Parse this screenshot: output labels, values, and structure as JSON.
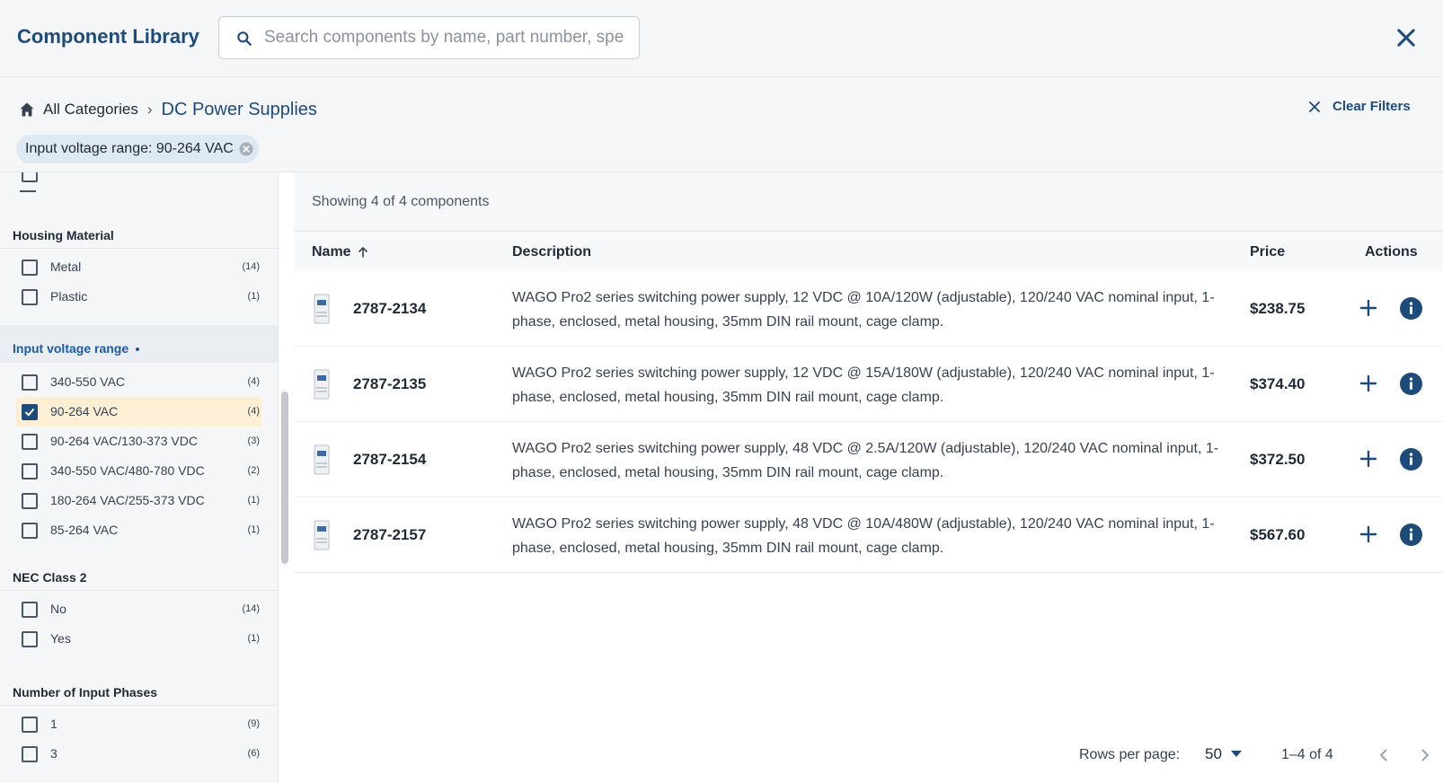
{
  "header": {
    "title": "Component Library",
    "search_placeholder": "Search components by name, part number, specification…",
    "search_value": ""
  },
  "breadcrumb": {
    "root": "All Categories",
    "separator": "›",
    "current": "DC Power Supplies"
  },
  "clear_filters_label": "Clear Filters",
  "active_filter_chip": "Input voltage range: 90-264 VAC",
  "sidebar": {
    "groups": [
      {
        "title": "Housing Material",
        "active": false,
        "options": [
          {
            "label": "Metal",
            "count": "(14)",
            "checked": false
          },
          {
            "label": "Plastic",
            "count": "(1)",
            "checked": false
          }
        ]
      },
      {
        "title": "Input voltage range",
        "active": true,
        "options": [
          {
            "label": "340-550 VAC",
            "count": "(4)",
            "checked": false
          },
          {
            "label": "90-264 VAC",
            "count": "(4)",
            "checked": true
          },
          {
            "label": "90-264 VAC/130-373 VDC",
            "count": "(3)",
            "checked": false
          },
          {
            "label": "340-550 VAC/480-780 VDC",
            "count": "(2)",
            "checked": false
          },
          {
            "label": "180-264 VAC/255-373 VDC",
            "count": "(1)",
            "checked": false
          },
          {
            "label": "85-264 VAC",
            "count": "(1)",
            "checked": false
          }
        ]
      },
      {
        "title": "NEC Class 2",
        "active": false,
        "options": [
          {
            "label": "No",
            "count": "(14)",
            "checked": false
          },
          {
            "label": "Yes",
            "count": "(1)",
            "checked": false
          }
        ]
      },
      {
        "title": "Number of Input Phases",
        "active": false,
        "options": [
          {
            "label": "1",
            "count": "(9)",
            "checked": false
          },
          {
            "label": "3",
            "count": "(6)",
            "checked": false
          }
        ]
      }
    ]
  },
  "results": {
    "showing_text": "Showing 4 of 4 components",
    "columns": {
      "name": "Name",
      "description": "Description",
      "price": "Price",
      "actions": "Actions"
    },
    "rows": [
      {
        "part_number": "2787-2134",
        "description": "WAGO Pro2 series switching power supply, 12 VDC @ 10A/120W (adjustable), 120/240 VAC nominal input, 1-phase, enclosed, metal housing, 35mm DIN rail mount, cage clamp.",
        "price": "$238.75"
      },
      {
        "part_number": "2787-2135",
        "description": "WAGO Pro2 series switching power supply, 12 VDC @ 15A/180W (adjustable), 120/240 VAC nominal input, 1-phase, enclosed, metal housing, 35mm DIN rail mount, cage clamp.",
        "price": "$374.40"
      },
      {
        "part_number": "2787-2154",
        "description": "WAGO Pro2 series switching power supply, 48 VDC @ 2.5A/120W (adjustable), 120/240 VAC nominal input, 1-phase, enclosed, metal housing, 35mm DIN rail mount, cage clamp.",
        "price": "$372.50"
      },
      {
        "part_number": "2787-2157",
        "description": "WAGO Pro2 series switching power supply, 48 VDC @ 10A/480W (adjustable), 120/240 VAC nominal input, 1-phase, enclosed, metal housing, 35mm DIN rail mount, cage clamp.",
        "price": "$567.60"
      }
    ]
  },
  "pagination": {
    "rows_per_page_label": "Rows per page:",
    "rows_per_page_value": "50",
    "range_text": "1–4 of 4"
  },
  "colors": {
    "brand": "#1e4b7a",
    "accent_link": "#1e5aa0",
    "checked_row_bg": "#fcefd6",
    "chip_bg": "#dfe9f4"
  }
}
